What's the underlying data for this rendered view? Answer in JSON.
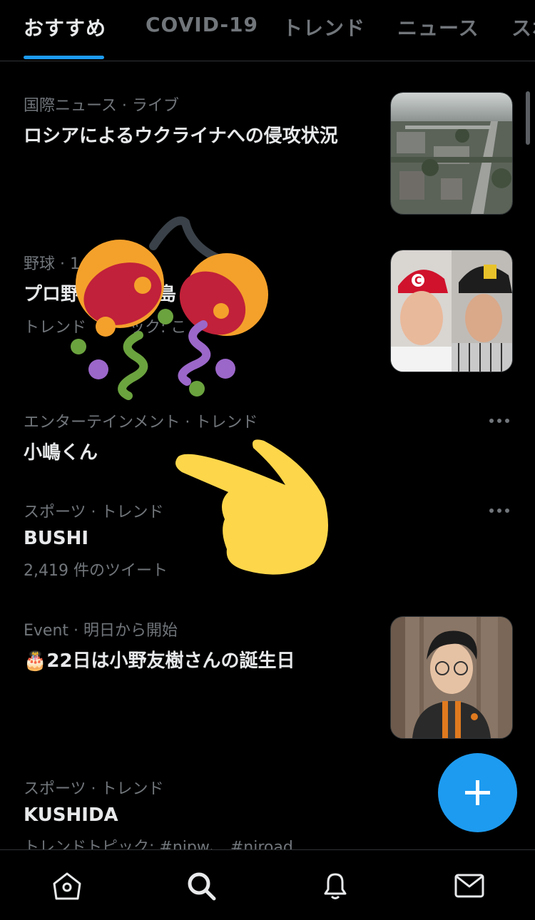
{
  "tabs": [
    {
      "label": "おすすめ",
      "active": true
    },
    {
      "label": "COVID-19",
      "active": false
    },
    {
      "label": "トレンド",
      "active": false
    },
    {
      "label": "ニュース",
      "active": false
    },
    {
      "label": "スポ",
      "active": false
    }
  ],
  "colors": {
    "accent": "#1d9bf0",
    "background": "#000000",
    "text": "#e7e9ea",
    "muted": "#71767b"
  },
  "feed": [
    {
      "category": "国際ニュース",
      "status": "· ライブ",
      "title": "ロシアによるウクライナへの侵攻状況",
      "sub": "",
      "thumbnail": "aerial-city-photo"
    },
    {
      "category": "野球 · 1",
      "status": "",
      "title": "プロ野",
      "title_tail": "島 v",
      "sub": "トレンド",
      "sub_tail": "ック: こ",
      "thumbnail": "baseball-players-photo"
    },
    {
      "category": "エンターテインメント · トレンド",
      "status": "",
      "title": "小嶋くん",
      "sub": "",
      "more": "more-icon"
    },
    {
      "category": "スポーツ · トレンド",
      "status": "",
      "title": "BUSHI",
      "sub": "2,419 件のツイート",
      "more": "more-icon"
    },
    {
      "category": "Event",
      "status": "· 明日から開始",
      "title": "🎂22日は小野友樹さんの誕生日",
      "sub": "",
      "thumbnail": "person-portrait-photo"
    },
    {
      "category": "スポーツ · トレンド",
      "status": "",
      "title": "KUSHIDA",
      "sub": "トレンドトピック: #njpw、 #njroad"
    }
  ],
  "fab": {
    "icon": "plus-icon",
    "label": "+"
  },
  "bottom_nav": [
    {
      "icon": "home-icon"
    },
    {
      "icon": "search-icon",
      "active": true
    },
    {
      "icon": "notifications-icon"
    },
    {
      "icon": "messages-icon"
    }
  ],
  "overlays": [
    "party-popper-emoji",
    "pointing-hand-emoji"
  ]
}
